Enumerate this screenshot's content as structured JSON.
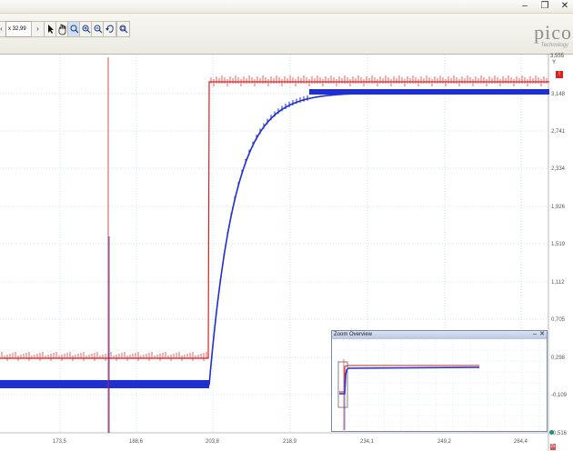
{
  "toolbar": {
    "nav_prev": "‹",
    "zoom_value": "x 32,99",
    "nav_next": "›",
    "tools": [
      "pointer-icon",
      "hand-icon",
      "zoom-box-icon",
      "zoom-in-icon",
      "zoom-out-icon",
      "undo-zoom-icon",
      "zoom-fit-icon"
    ]
  },
  "window_controls": {
    "minimize": "–",
    "restore": "❐",
    "close": "✕"
  },
  "logo": {
    "word": "pico",
    "sub": "Technology"
  },
  "y_axis": {
    "label_top": "3,555",
    "label_y": "Y",
    "marker": "!",
    "ticks": [
      "3,148",
      "2,741",
      "2,334",
      "1,926",
      "1,519",
      "1,112",
      "0,705",
      "0,298",
      "-0,109",
      "-0,516"
    ]
  },
  "x_axis": {
    "ticks": [
      "173,5",
      "188,6",
      "203,8",
      "218,9",
      "234,1",
      "249,2",
      "264,4"
    ]
  },
  "overview": {
    "title": "Zoom Overview",
    "minimize": "–",
    "close": "✕"
  },
  "channel_marker": "2x",
  "colors": {
    "channel_a": "#dd1f1f",
    "channel_b": "#1f2fd0",
    "grid": "#9fd0e6"
  }
}
